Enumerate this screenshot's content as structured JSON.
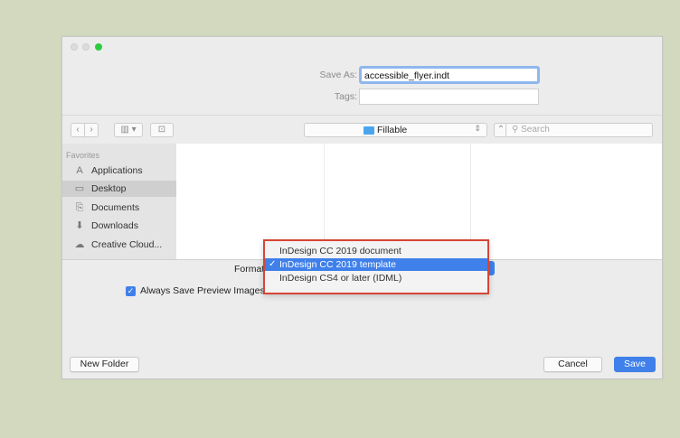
{
  "dialog": {
    "save_as_label": "Save As:",
    "filename": "accessible_flyer.indt",
    "tags_label": "Tags:",
    "tags_value": ""
  },
  "toolbar": {
    "back_glyph": "‹",
    "forward_glyph": "›",
    "view_glyph": "▥ ▾",
    "new_folder_glyph": "⊡",
    "location": "Fillable",
    "location_arrows": "⇕",
    "collapse_glyph": "⌃",
    "search_placeholder": "Search"
  },
  "sidebar": {
    "heading": "Favorites",
    "items": [
      {
        "label": "Applications",
        "icon": "applications-icon",
        "glyph": "A"
      },
      {
        "label": "Desktop",
        "icon": "desktop-icon",
        "glyph": "▭"
      },
      {
        "label": "Documents",
        "icon": "documents-icon",
        "glyph": "⎘"
      },
      {
        "label": "Downloads",
        "icon": "downloads-icon",
        "glyph": "⬇"
      },
      {
        "label": "Creative Cloud...",
        "icon": "creative-cloud-icon",
        "glyph": "☁"
      }
    ]
  },
  "format": {
    "label": "Format",
    "options": [
      "InDesign CC 2019 document",
      "InDesign CC 2019 template",
      "InDesign CS4 or later (IDML)"
    ],
    "selected_index": 1,
    "check_glyph": "✓"
  },
  "preview": {
    "label": "Always Save Preview Images",
    "checked": true,
    "check_glyph": "✓"
  },
  "buttons": {
    "new_folder": "New Folder",
    "cancel": "Cancel",
    "save": "Save"
  },
  "colors": {
    "accent": "#3f80ea",
    "highlight_border": "#d64535",
    "background": "#d3d9bf"
  }
}
